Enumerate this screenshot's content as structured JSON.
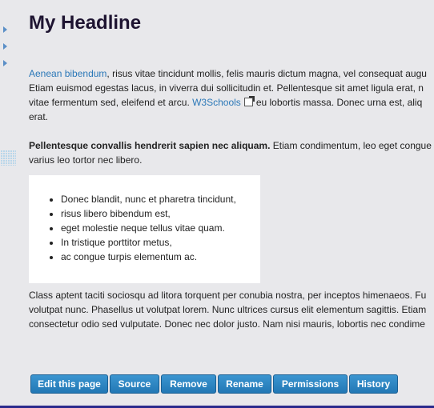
{
  "page": {
    "headline": "My Headline",
    "para1": {
      "link1": "Aenean bibendum",
      "line1_rest": ", risus vitae tincidunt mollis, felis mauris dictum magna, vel consequat augu",
      "line2": "Etiam euismod egestas lacus, in viverra dui sollicitudin et. Pellentesque sit amet ligula erat, n",
      "line3_pre": "vitae fermentum sed, eleifend et arcu. ",
      "link2": "W3Schools",
      "line3_post": "eu lobortis massa. Donec urna est, aliq",
      "line4": "erat."
    },
    "para2": {
      "bold": "Pellentesque convallis hendrerit sapien nec aliquam.",
      "line1_rest": " Etiam condimentum, leo eget congue",
      "line2": "varius leo tortor nec libero."
    },
    "list": [
      "Donec blandit, nunc et pharetra tincidunt,",
      "risus libero bibendum est,",
      "eget molestie neque tellus vitae quam.",
      "In tristique porttitor metus,",
      "ac congue turpis elementum ac."
    ],
    "para3": {
      "line1": "Class aptent taciti sociosqu ad litora torquent per conubia nostra, per inceptos himenaeos. Fu",
      "line2": "volutpat nunc. Phasellus ut volutpat lorem. Nunc ultrices cursus elit elementum sagittis. Etiam",
      "line3": "consectetur odio sed vulputate. Donec nec dolor justo. Nam nisi mauris, lobortis nec condime"
    }
  },
  "buttons": {
    "edit": "Edit this page",
    "source": "Source",
    "remove": "Remove",
    "rename": "Rename",
    "permissions": "Permissions",
    "history": "History"
  },
  "icons": {
    "sidebar_arrow": "chevron-right-icon",
    "external_link": "external-link-icon"
  },
  "colors": {
    "link": "#2b78b8",
    "button": "#2278b5",
    "headline": "#1e1431"
  }
}
